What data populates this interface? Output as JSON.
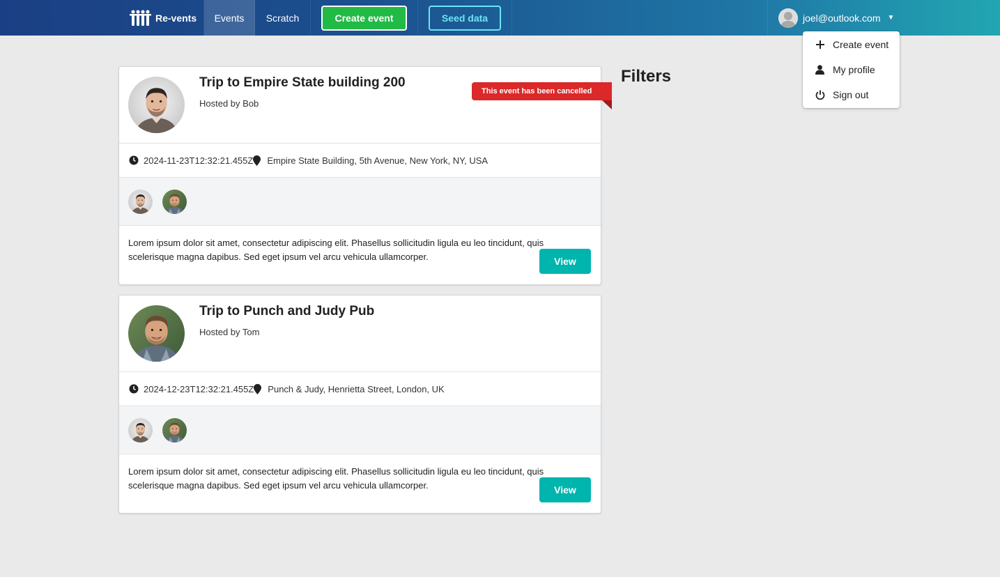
{
  "nav": {
    "brand": "Re-vents",
    "events": "Events",
    "scratch": "Scratch",
    "create_event": "Create event",
    "seed_data": "Seed data",
    "user_email": "joel@outlook.com",
    "colors": {
      "create": "#21ba45",
      "seed": "#6fe3f5"
    }
  },
  "dropdown": {
    "items": [
      {
        "label": "Create event",
        "icon": "plus-icon"
      },
      {
        "label": "My profile",
        "icon": "user-icon"
      },
      {
        "label": "Sign out",
        "icon": "power-icon"
      }
    ]
  },
  "events": [
    {
      "title": "Trip to Empire State building 200",
      "host": "Hosted by Bob",
      "cancelled_label": "This event has been cancelled",
      "date": "2024-11-23T12:32:21.455Z",
      "venue": "Empire State Building, 5th Avenue, New York, NY, USA",
      "description": "Lorem ipsum dolor sit amet, consectetur adipiscing elit. Phasellus sollicitudin ligula eu leo tincidunt, quis scelerisque magna dapibus. Sed eget ipsum vel arcu vehicula ullamcorper.",
      "view_label": "View"
    },
    {
      "title": "Trip to Punch and Judy Pub",
      "host": "Hosted by Tom",
      "date": "2024-12-23T12:32:21.455Z",
      "venue": "Punch & Judy, Henrietta Street, London, UK",
      "description": "Lorem ipsum dolor sit amet, consectetur adipiscing elit. Phasellus sollicitudin ligula eu leo tincidunt, quis scelerisque magna dapibus. Sed eget ipsum vel arcu vehicula ullamcorper.",
      "view_label": "View"
    }
  ],
  "sidebar": {
    "filters_title": "Filters"
  },
  "colors": {
    "cancelled": "#db2828",
    "view_button": "#00b5ad"
  }
}
